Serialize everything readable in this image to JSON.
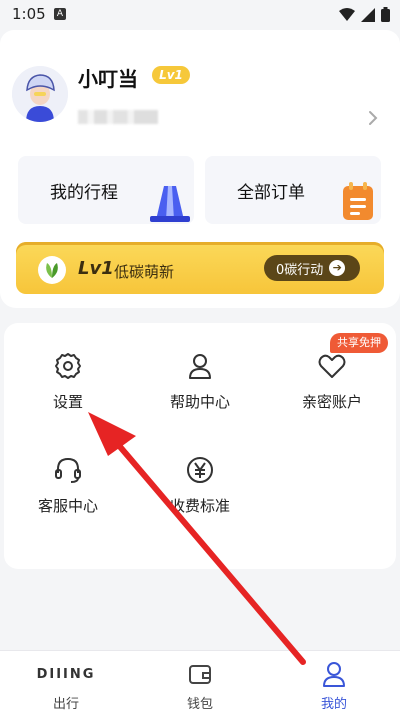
{
  "status_bar": {
    "time": "1:05",
    "notif_letter": "A"
  },
  "profile": {
    "username": "小叮当",
    "level_badge": "Lv1"
  },
  "quick_links": {
    "trips": "我的行程",
    "orders": "全部订单"
  },
  "eco_banner": {
    "level": "Lv1",
    "title": "低碳萌新",
    "action": "0碳行动"
  },
  "menu": {
    "settings": "设置",
    "help": "帮助中心",
    "family": "亲密账户",
    "family_badge": "共享免押",
    "service": "客服中心",
    "fees": "收费标准"
  },
  "bottom_nav": {
    "brand": "DIIING",
    "out": "出行",
    "wallet": "钱包",
    "mine": "我的"
  },
  "colors": {
    "accent": "#3a56d8",
    "banner": "#f7c53a",
    "arrow": "#e62424",
    "badge": "#ef5a36"
  }
}
